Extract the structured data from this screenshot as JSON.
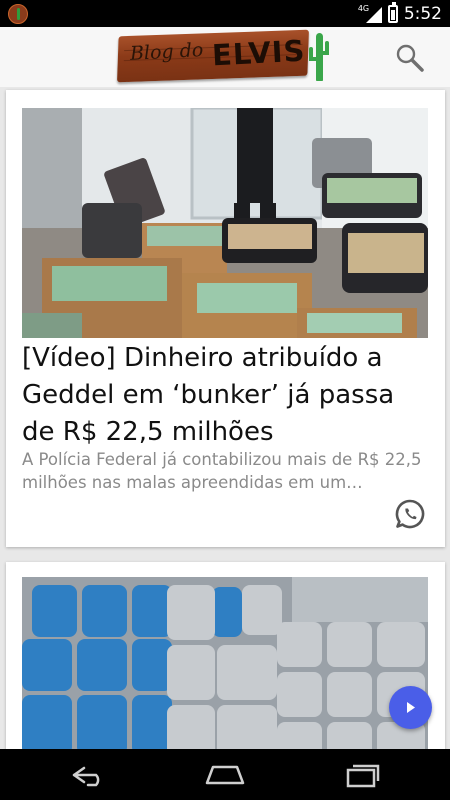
{
  "status_bar": {
    "network": "4G",
    "time": "5:52"
  },
  "app_bar": {
    "logo_text_script": "Blog do",
    "logo_text_bold": "ELVIS"
  },
  "posts": [
    {
      "title": "[Vídeo] Dinheiro atribuído a Geddel em ‘bunker’ já passa de R$ 22,5 milhões",
      "excerpt": "A Polícia Federal já contabilizou mais de R$ 22,5 milhões nas malas apreendidas em um…",
      "share_icon": "whatsapp-icon"
    },
    {
      "title": "",
      "excerpt": ""
    }
  ],
  "fab": {
    "icon": "play-arrow-icon"
  },
  "nav": {
    "back": "back-icon",
    "home": "home-icon",
    "recents": "recents-icon"
  },
  "colors": {
    "fab": "#4a5ee8",
    "cactus": "#3aa64a",
    "plank": "#8b3a18"
  }
}
